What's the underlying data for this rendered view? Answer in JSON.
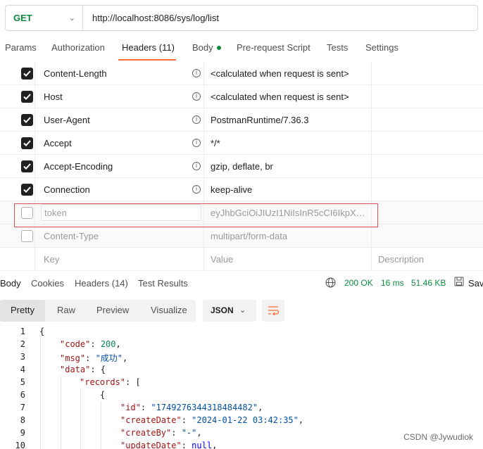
{
  "request": {
    "method": "GET",
    "url": "http://localhost:8086/sys/log/list"
  },
  "request_tabs": {
    "params": "Params",
    "authorization": "Authorization",
    "headers": "Headers (11)",
    "body": "Body",
    "prerequest": "Pre-request Script",
    "tests": "Tests",
    "settings": "Settings"
  },
  "headers": [
    {
      "key": "Content-Length",
      "value": "<calculated when request is sent>",
      "checked": true
    },
    {
      "key": "Host",
      "value": "<calculated when request is sent>",
      "checked": true
    },
    {
      "key": "User-Agent",
      "value": "PostmanRuntime/7.36.3",
      "checked": true
    },
    {
      "key": "Accept",
      "value": "*/*",
      "checked": true
    },
    {
      "key": "Accept-Encoding",
      "value": "gzip, deflate, br",
      "checked": true
    },
    {
      "key": "Connection",
      "value": "keep-alive",
      "checked": true
    },
    {
      "key": "token",
      "value": "eyJhbGciOiJIUzI1NiIsInR5cCI6IkpXVC...",
      "checked": false
    },
    {
      "key": "Content-Type",
      "value": "multipart/form-data",
      "checked": false
    }
  ],
  "headers_placeholder": {
    "key": "Key",
    "value": "Value",
    "description": "Description"
  },
  "response_tabs": {
    "body": "Body",
    "cookies": "Cookies",
    "headers": "Headers (14)",
    "test_results": "Test Results"
  },
  "response_status": {
    "status": "200 OK",
    "time": "16 ms",
    "size": "51.46 KB",
    "save": "Sav"
  },
  "format_tabs": {
    "pretty": "Pretty",
    "raw": "Raw",
    "preview": "Preview",
    "visualize": "Visualize",
    "language": "JSON"
  },
  "code": {
    "line_numbers": [
      "1",
      "2",
      "3",
      "4",
      "5",
      "6",
      "7",
      "8",
      "9",
      "10"
    ],
    "l1": "{",
    "l2_key": "\"code\"",
    "l2_val": "200",
    "l3_key": "\"msg\"",
    "l3_val": "\"成功\"",
    "l4_key": "\"data\"",
    "l4_rest": ": {",
    "l5_key": "\"records\"",
    "l5_rest": ": [",
    "l6": "{",
    "l7_key": "\"id\"",
    "l7_val": "\"1749276344318484482\"",
    "l8_key": "\"createDate\"",
    "l8_val": "\"2024-01-22 03:42:35\"",
    "l9_key": "\"createBy\"",
    "l9_val": "\"-\"",
    "l10_key": "\"updateDate\"",
    "l10_val": "null"
  },
  "watermark": "CSDN @Jywudiok",
  "colors": {
    "accent": "#ff6c37",
    "method_green": "#0b8a3e",
    "highlight_box": "#d9534f"
  }
}
